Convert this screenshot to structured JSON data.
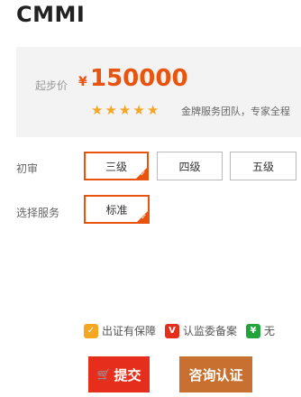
{
  "product": {
    "title": "CMMI"
  },
  "price": {
    "label": "起步价",
    "currency": "¥",
    "amount": "150000",
    "rating": 5,
    "stars": [
      "★",
      "★",
      "★",
      "★",
      "★"
    ],
    "description": "金牌服务团队，专家全程"
  },
  "options": [
    {
      "label": "初审",
      "choices": [
        "三级",
        "四级",
        "五级"
      ],
      "selected": "三级"
    },
    {
      "label": "选择服务",
      "choices": [
        "标准"
      ],
      "selected": "标准"
    }
  ],
  "guarantees": [
    {
      "icon": "shield-icon",
      "icon_glyph": "✓",
      "color": "#f5a623",
      "text": "出证有保障"
    },
    {
      "icon": "v-badge-icon",
      "icon_glyph": "V",
      "color": "#e62e1c",
      "text": "认监委备案"
    },
    {
      "icon": "leaf-icon",
      "icon_glyph": "¥",
      "color": "#22a33c",
      "text": "无"
    }
  ],
  "actions": {
    "submit_icon": "🛒",
    "submit": "提交",
    "consult": "咨询认证"
  },
  "colors": {
    "accent": "#e8540e",
    "submit_bg": "#e62e1c",
    "consult_bg": "#c7702f",
    "star": "#f5a623"
  }
}
